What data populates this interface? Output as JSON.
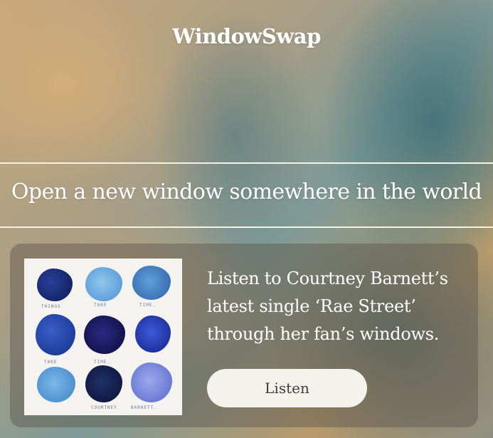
{
  "header": {
    "logo": "WindowSwap"
  },
  "hero": {
    "tagline": "Open a new window somewhere in the world"
  },
  "promo": {
    "text": "Listen to Courtney Barnett’s latest single ‘Rae Street’ through her fan’s windows.",
    "button_label": "Listen",
    "artwork_words": [
      "THINGS",
      "TAKE",
      "TIME.",
      "TAKE",
      "TIME.",
      "COURTNEY",
      "BARNETT."
    ]
  }
}
